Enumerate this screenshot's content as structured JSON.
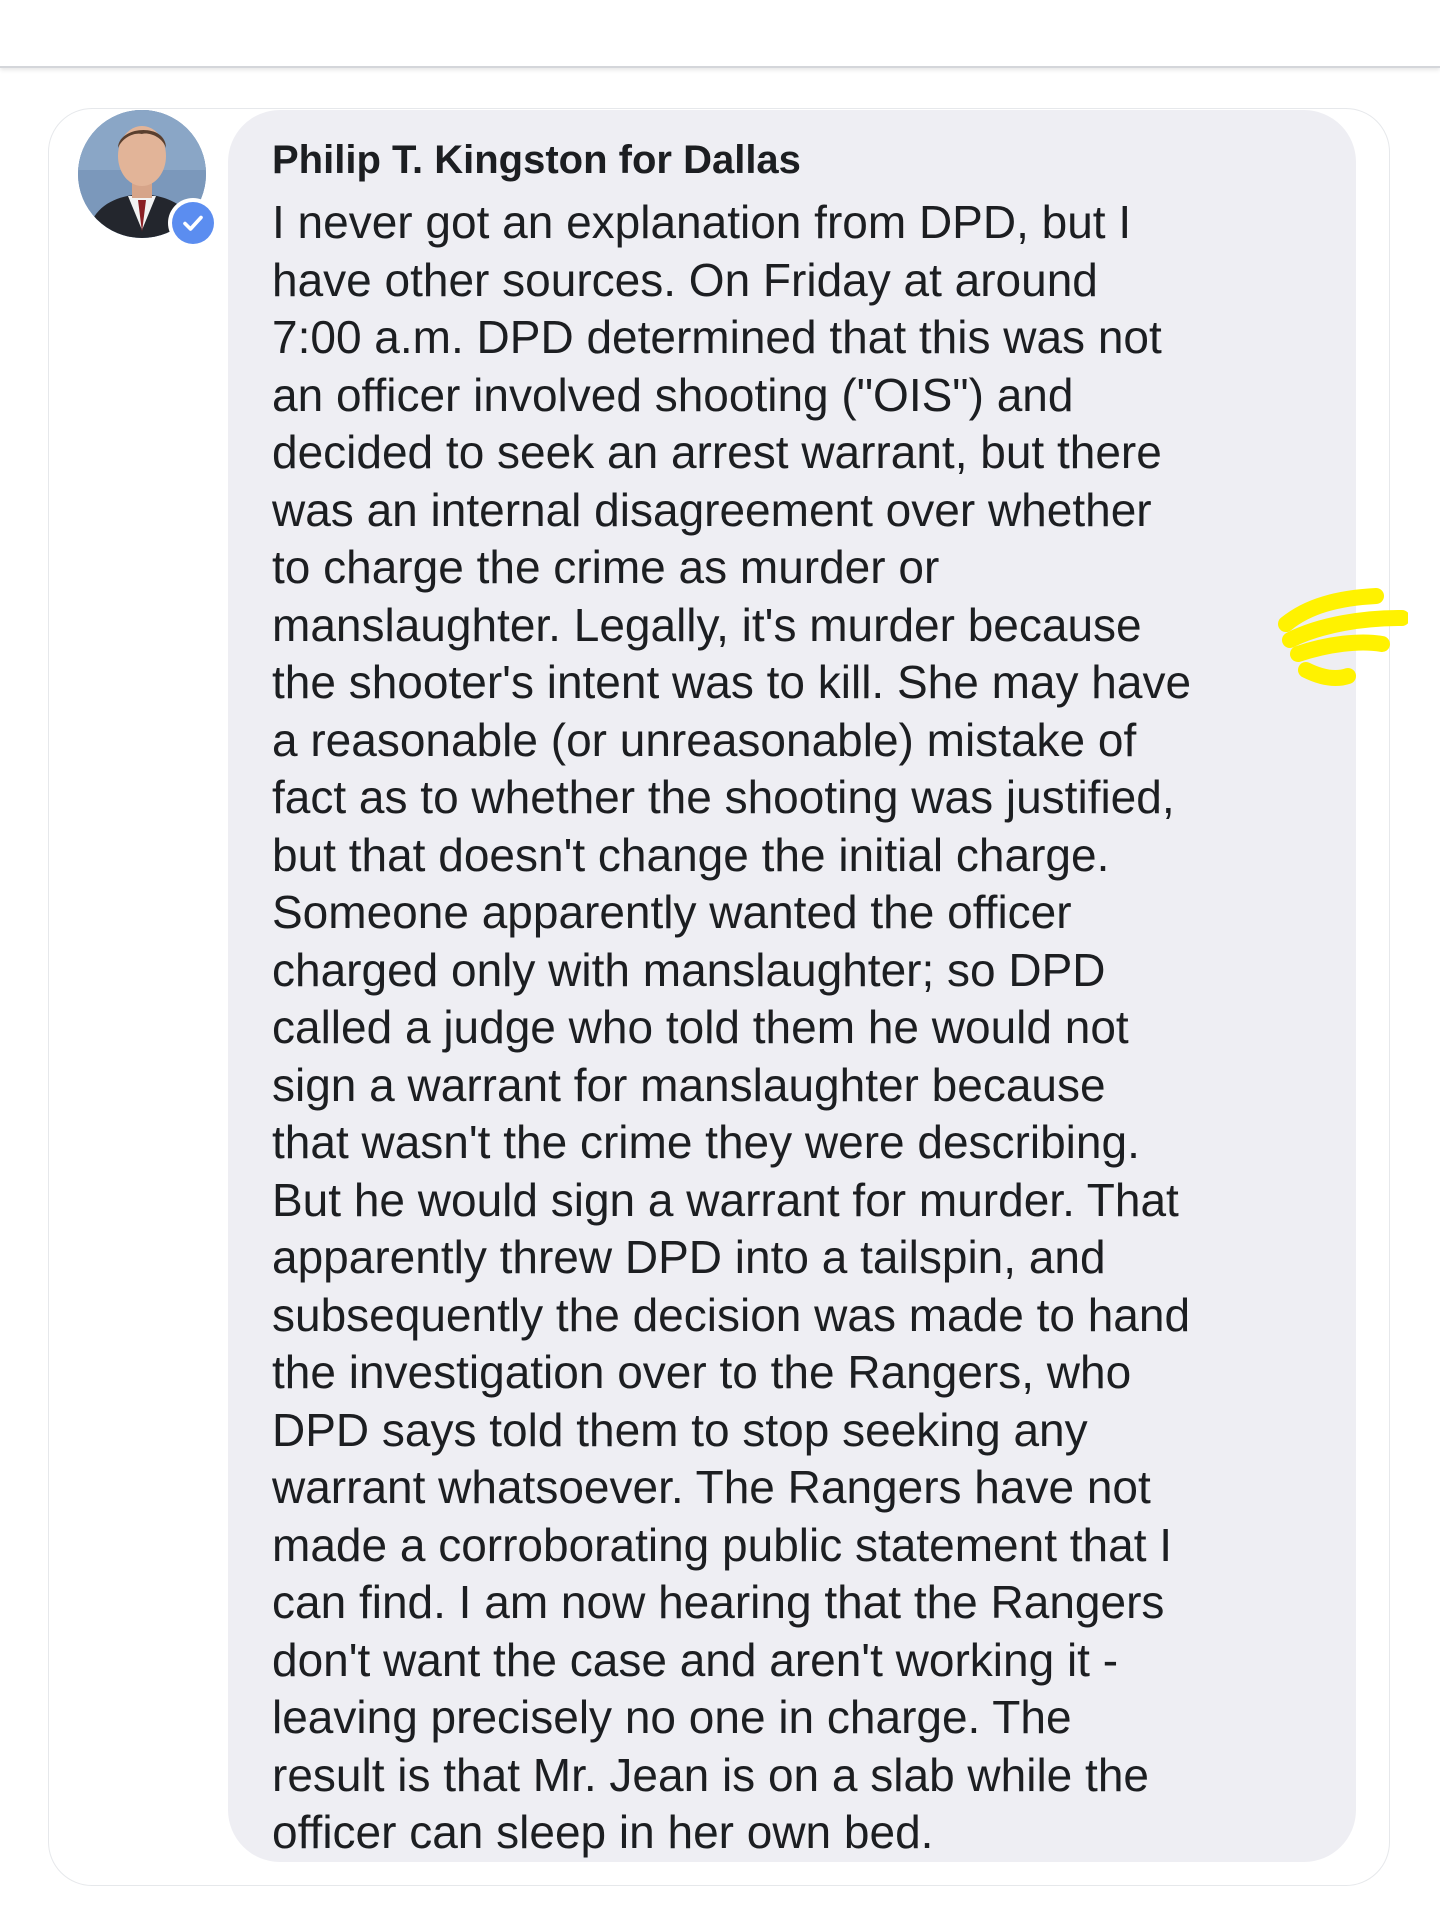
{
  "comment": {
    "author": "Philip T. Kingston for Dallas",
    "verified": true,
    "avatar_icon": "profile-photo",
    "badge_icon": "verified-check-icon",
    "colors": {
      "bubble": "#eeeef3",
      "verified_badge": "#5b8df0",
      "highlight": "#fff200"
    },
    "lines": [
      "I never got an explanation from DPD, but I",
      "have other sources. On Friday at around",
      "7:00 a.m. DPD determined that this was not",
      "an officer involved shooting (\"OIS\") and",
      "decided to seek an arrest warrant, but there",
      "was an internal disagreement over whether",
      "to charge the crime as murder or",
      "manslaughter. Legally, it's murder because",
      "the shooter's intent was to kill. She may have",
      "a reasonable (or unreasonable) mistake of",
      "fact as to whether the shooting was justified,",
      "but that doesn't change the initial charge.",
      "Someone apparently wanted the officer",
      "charged only with manslaughter; so DPD",
      "called a judge who told them he would not",
      "sign a warrant for manslaughter because",
      "that wasn't the crime they were describing.",
      "But he would sign a warrant for murder. That",
      "apparently threw DPD into a tailspin, and",
      "subsequently the decision was made to hand",
      "the investigation over to the Rangers, who",
      "DPD says told them to stop seeking any",
      "warrant whatsoever. The Rangers have not",
      "made a corroborating public statement that I",
      "can find. I am now hearing that the Rangers",
      "don't want the case and aren't working it -",
      "leaving precisely no one in charge. The",
      "result is that Mr. Jean is on a slab while the",
      "officer can sleep in her own bed."
    ]
  }
}
